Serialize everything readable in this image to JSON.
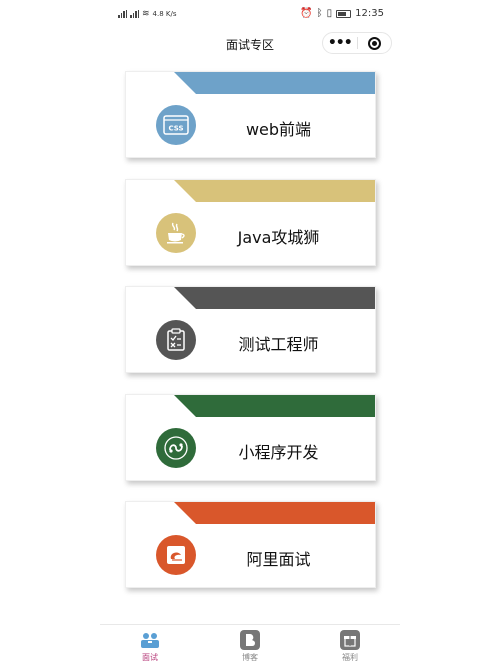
{
  "status_bar": {
    "left_text": "4.8 K/s",
    "time": "12:35"
  },
  "nav": {
    "title": "面试专区",
    "more_label": "•••"
  },
  "cards": [
    {
      "label": "web前端",
      "color": "#6ea2c9",
      "icon": "css-icon",
      "icon_text": "CSS"
    },
    {
      "label": "Java攻城狮",
      "color": "#d8c27a",
      "icon": "java-cup-icon",
      "icon_text": ""
    },
    {
      "label": "测试工程师",
      "color": "#555555",
      "icon": "clipboard-check-icon",
      "icon_text": ""
    },
    {
      "label": "小程序开发",
      "color": "#2f6b3a",
      "icon": "mini-program-icon",
      "icon_text": ""
    },
    {
      "label": "阿里面试",
      "color": "#d9572b",
      "icon": "alibaba-icon",
      "icon_text": ""
    }
  ],
  "tabs": [
    {
      "label": "面试",
      "icon": "interview-icon",
      "active": true
    },
    {
      "label": "博客",
      "icon": "blog-icon",
      "active": false
    },
    {
      "label": "福利",
      "icon": "gift-icon",
      "active": false
    }
  ],
  "colors": {
    "accent": "#b53a78"
  }
}
